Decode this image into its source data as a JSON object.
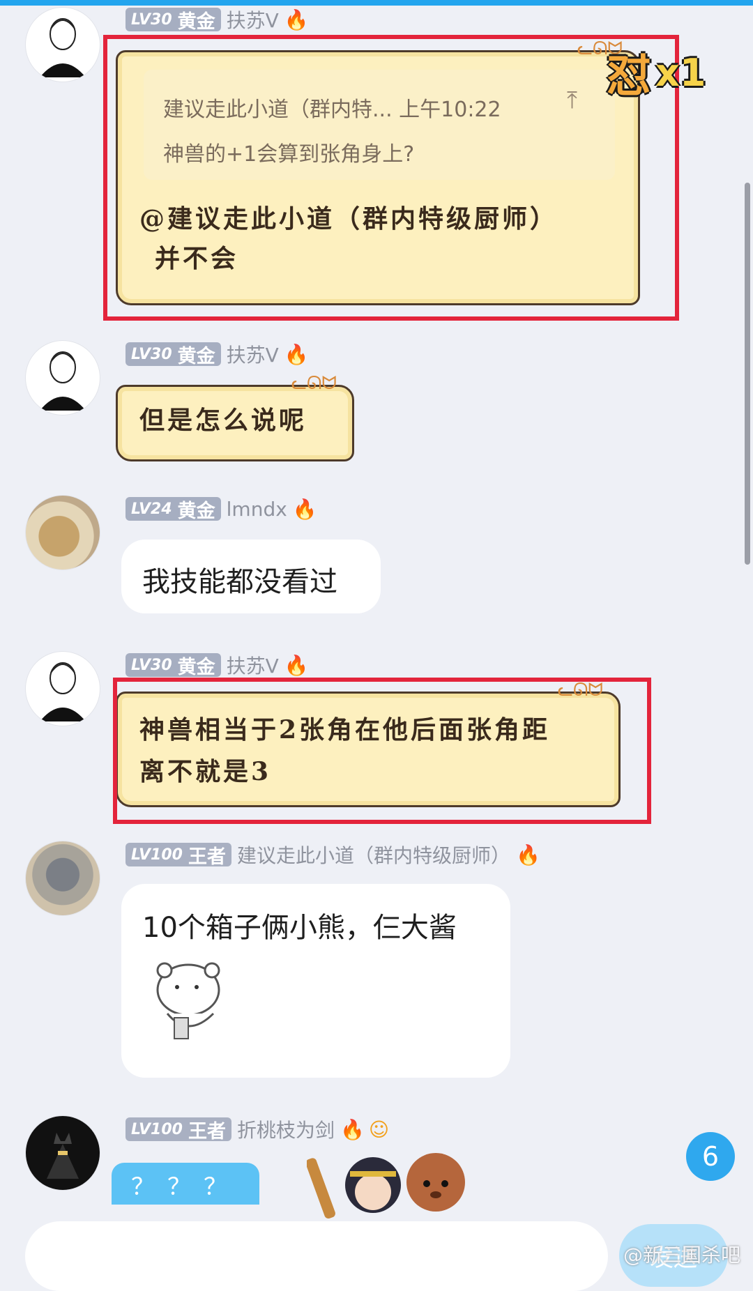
{
  "messages": [
    {
      "level": "LV30",
      "tier": "黄金",
      "nickname": "扶苏V",
      "quote_line1": "建议走此小道（群内特... 上午10:22",
      "quote_line2": "神兽的+1会算到张角身上?",
      "reply_line1": "@建议走此小道（群内特级厨师）",
      "reply_line2": "并不会"
    },
    {
      "level": "LV30",
      "tier": "黄金",
      "nickname": "扶苏V",
      "text": "但是怎么说呢"
    },
    {
      "level": "LV24",
      "tier": "黄金",
      "nickname": "lmndx",
      "text": "我技能都没看过"
    },
    {
      "level": "LV30",
      "tier": "黄金",
      "nickname": "扶苏V",
      "text_line1": "神兽相当于2张角在他后面张角距",
      "text_line2": "离不就是3"
    },
    {
      "level": "LV100",
      "tier": "王者",
      "nickname": "建议走此小道（群内特级厨师）",
      "text": "10个箱子俩小熊，仨大酱"
    },
    {
      "level": "LV100",
      "tier": "王者",
      "nickname": "折桃枝为剑",
      "partial_text": "？？？"
    }
  ],
  "combo": {
    "glyph": "怼",
    "count": "x1"
  },
  "unread_count": "6",
  "send_label": "发送",
  "watermark": "@新三国杀吧",
  "colors": {
    "highlight": "#e3243b",
    "accent": "#23a5ee"
  }
}
